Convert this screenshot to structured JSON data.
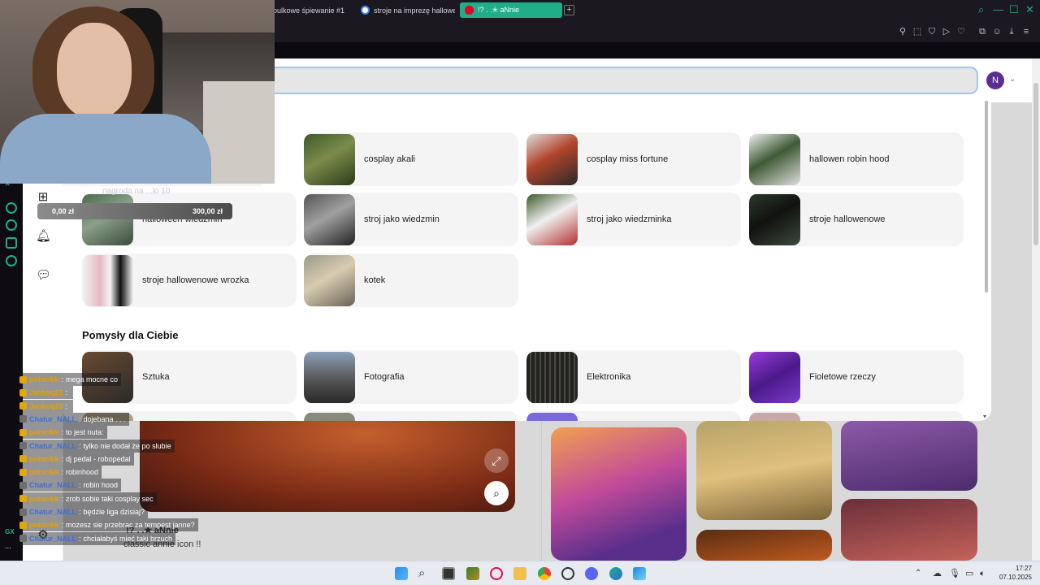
{
  "tabs": [
    {
      "label": "bulkowe śpiewanie #1",
      "active": false
    },
    {
      "label": "stroje na imprezę hallowe",
      "active": false
    },
    {
      "label": "!? . .✭ aNnie",
      "active": true
    }
  ],
  "search": {
    "value": ""
  },
  "user": {
    "avatar_letter": "N"
  },
  "recent_searches": [
    {
      "label": "cosplay akali"
    },
    {
      "label": "cosplay miss fortune"
    },
    {
      "label": "hallowen robin hood"
    },
    {
      "label": "halloween wiedzmin"
    },
    {
      "label": "stroj jako wiedzmin"
    },
    {
      "label": "stroj jako wiedzminka"
    },
    {
      "label": "stroje hallowenowe"
    },
    {
      "label": "stroje hallowenowe wrozka"
    },
    {
      "label": "kotek"
    }
  ],
  "ideas": {
    "title": "Pomysły dla Ciebie",
    "items": [
      {
        "label": "Sztuka"
      },
      {
        "label": "Fotografia"
      },
      {
        "label": "Elektronika"
      },
      {
        "label": "Fioletowe rzeczy"
      }
    ]
  },
  "pin": {
    "title": "!? . .✭ aNnie",
    "caption": "classic annie icon !!"
  },
  "stream": {
    "donation": {
      "title": "nagroda na ...lo 10",
      "left_amount": "0,00 zł",
      "right_amount": "300,00 zł"
    }
  },
  "chat": [
    {
      "user": "poincikk",
      "color": "#e8a000",
      "msg": "mega mocne co"
    },
    {
      "user": "Jankoq23",
      "color": "#e8a000",
      "msg": ""
    },
    {
      "user": "Jankoq23",
      "color": "#e8a000",
      "msg": ""
    },
    {
      "user": "Chatur_NALL",
      "color": "#3d6fd8",
      "msg": "dojebana . . ."
    },
    {
      "user": "poincikk",
      "color": "#e8a000",
      "msg": "to jest nuta:"
    },
    {
      "user": "Chatur_NALL",
      "color": "#3d6fd8",
      "msg": "tylko nie dodał że po slubie"
    },
    {
      "user": "poincikk",
      "color": "#e8a000",
      "msg": "dj pedal - robopedal"
    },
    {
      "user": "poincikk",
      "color": "#e8a000",
      "msg": "robinhood"
    },
    {
      "user": "Chatur_NALL",
      "color": "#3d6fd8",
      "msg": "robin hood"
    },
    {
      "user": "poincikk",
      "color": "#e8a000",
      "msg": "zrob sobie taki cosplay sec"
    },
    {
      "user": "Chatur_NALL",
      "color": "#3d6fd8",
      "msg": "będzie liga dzisiaj?"
    },
    {
      "user": "poincikk",
      "color": "#e8a000",
      "msg": "mozesz sie przebrac za tempest janne?"
    },
    {
      "user": "Chatur_NALL",
      "color": "#3d6fd8",
      "msg": "chciałabyś mieć taki brzuch"
    }
  ],
  "opera": {
    "gx_label": "GX"
  },
  "taskbar": {
    "time": "17:27",
    "date": "07.10.2025"
  }
}
